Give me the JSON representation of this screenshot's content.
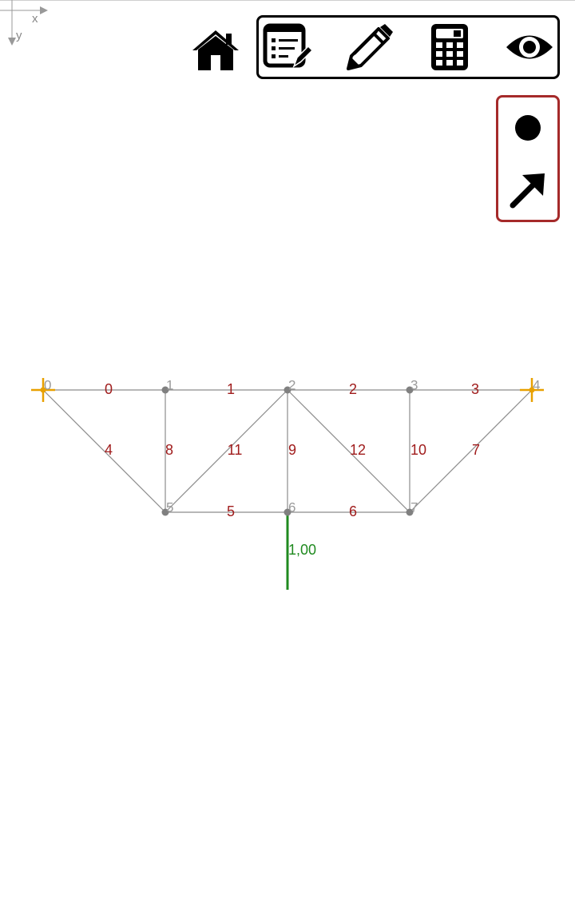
{
  "axes": {
    "x_label": "x",
    "y_label": "y"
  },
  "toolbar": {
    "home_icon": "home-icon",
    "tools": [
      "list-edit-icon",
      "pencil-icon",
      "calculator-icon",
      "eye-icon"
    ],
    "border_color": "#000000"
  },
  "side_panel": {
    "tools": [
      "node-dot-icon",
      "arrow-icon"
    ],
    "border_color": "#a52a2a"
  },
  "colors": {
    "member_line": "#8c8c8c",
    "node": "#808080",
    "node_label": "#9a9a9a",
    "member_label": "#a01c1c",
    "support": "#e8a000",
    "load": "#1f8a1f"
  },
  "truss": {
    "nodes": [
      {
        "id": "0",
        "label": "0"
      },
      {
        "id": "1",
        "label": "1"
      },
      {
        "id": "2",
        "label": "2"
      },
      {
        "id": "3",
        "label": "3"
      },
      {
        "id": "4",
        "label": "4"
      },
      {
        "id": "5",
        "label": "5"
      },
      {
        "id": "6",
        "label": "6"
      },
      {
        "id": "7",
        "label": "7"
      }
    ],
    "members": [
      {
        "label": "0",
        "from": 0,
        "to": 1
      },
      {
        "label": "1",
        "from": 1,
        "to": 2
      },
      {
        "label": "2",
        "from": 2,
        "to": 3
      },
      {
        "label": "3",
        "from": 3,
        "to": 4
      },
      {
        "label": "4",
        "from": 0,
        "to": 5
      },
      {
        "label": "5",
        "from": 5,
        "to": 6
      },
      {
        "label": "6",
        "from": 6,
        "to": 7
      },
      {
        "label": "7",
        "from": 7,
        "to": 4
      },
      {
        "label": "8",
        "from": 1,
        "to": 5
      },
      {
        "label": "9",
        "from": 2,
        "to": 6
      },
      {
        "label": "10",
        "from": 3,
        "to": 7
      },
      {
        "label": "11",
        "from": 5,
        "to": 2
      },
      {
        "label": "12",
        "from": 2,
        "to": 7
      }
    ],
    "supports": [
      0,
      4
    ],
    "loads": [
      {
        "node": 6,
        "value": "1,00"
      }
    ]
  }
}
